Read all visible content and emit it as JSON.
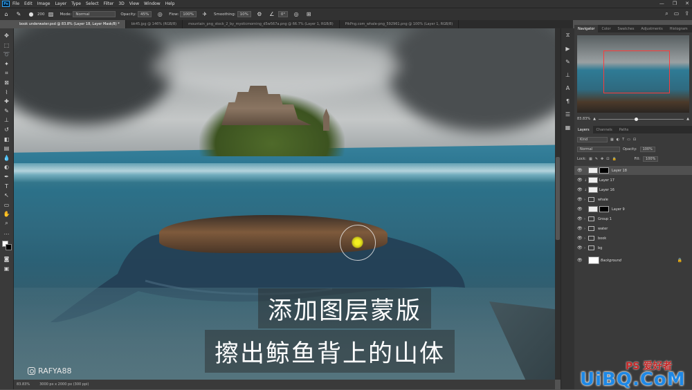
{
  "menubar": {
    "logo": "Ps",
    "items": [
      "File",
      "Edit",
      "Image",
      "Layer",
      "Type",
      "Select",
      "Filter",
      "3D",
      "View",
      "Window",
      "Help"
    ],
    "window_controls": [
      "—",
      "❐",
      "✕"
    ]
  },
  "options": {
    "brush_size": "200",
    "mode_label": "Mode:",
    "mode_value": "Normal",
    "opacity_label": "Opacity:",
    "opacity_value": "45%",
    "flow_label": "Flow:",
    "flow_value": "100%",
    "smoothing_label": "Smoothing:",
    "smoothing_value": "10%",
    "angle_value": "0°"
  },
  "tabs": [
    {
      "label": "book underwater.psd @ 83.8% (Layer 18, Layer Mask/8) *",
      "active": true
    },
    {
      "label": "bk45.jpg @ 146% (RGB/8)",
      "active": false
    },
    {
      "label": "mountain_png_stock_2_by_mysticmorning_d5w567a.png @ 66.7% (Layer 1, RGB/8)",
      "active": false
    },
    {
      "label": "PikPng.com_whale-png_592961.png @ 100% (Layer 1, RGB/8)",
      "active": false
    }
  ],
  "canvas": {
    "subtitle_line1": "添加图层蒙版",
    "subtitle_line2": "擦出鲸鱼背上的山体",
    "watermark": "RAFYA88"
  },
  "status": {
    "zoom": "83.83%",
    "doc_size": "3000 px x 2000 px (300 ppi)"
  },
  "panels": {
    "top_tabs": [
      "Navigator",
      "Color",
      "Swatches",
      "Adjustments",
      "Histogram"
    ],
    "nav_zoom": "83.83%",
    "layer_tabs": [
      "Layers",
      "Channels",
      "Paths"
    ],
    "filter_kind": "Kind",
    "blend_mode": "Normal",
    "opacity_label": "Opacity:",
    "opacity_value": "100%",
    "lock_label": "Lock:",
    "fill_label": "Fill:",
    "fill_value": "100%",
    "layers": [
      {
        "name": "Layer 18",
        "type": "mask",
        "selected": true
      },
      {
        "name": "Layer 17",
        "type": "clip",
        "selected": false
      },
      {
        "name": "Layer 16",
        "type": "clip",
        "selected": false
      },
      {
        "name": "whale",
        "type": "group",
        "selected": false
      },
      {
        "name": "Layer 9",
        "type": "mask",
        "selected": false
      },
      {
        "name": "Group 1",
        "type": "group",
        "selected": false
      },
      {
        "name": "water",
        "type": "group",
        "selected": false
      },
      {
        "name": "book",
        "type": "group",
        "selected": false
      },
      {
        "name": "bg",
        "type": "group",
        "selected": false
      },
      {
        "name": "Background",
        "type": "background",
        "selected": false
      }
    ]
  },
  "site_watermark": {
    "brand": "UiBQ.CoM",
    "ps_label": "PS 爱好者"
  }
}
